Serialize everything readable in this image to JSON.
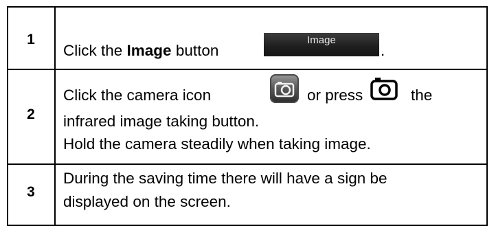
{
  "steps": [
    {
      "number": "1",
      "lines": [
        {
          "before": "Click the ",
          "bold": "Image",
          "after": " button"
        }
      ],
      "button_label": "Image",
      "trailing": "."
    },
    {
      "number": "2",
      "line1_a": "Click the camera icon",
      "line1_b": "or press",
      "line1_c": "the",
      "line2": "infrared image taking button.",
      "line3": "Hold the camera steadily when taking image.",
      "icons": [
        "camera-app-icon",
        "camera-button-icon"
      ]
    },
    {
      "number": "3",
      "line1": "During the saving time there will have a sign be",
      "line2": "displayed on the screen."
    }
  ]
}
